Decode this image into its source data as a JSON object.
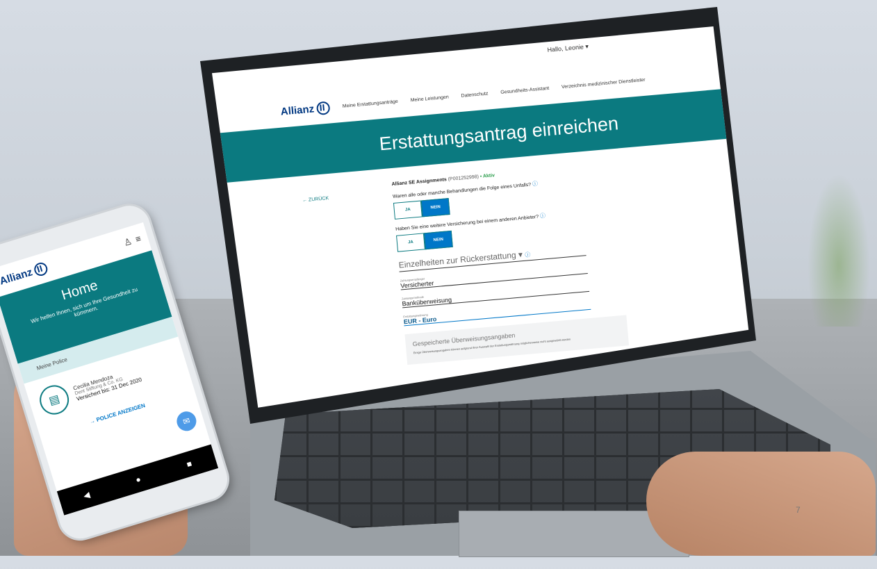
{
  "laptop": {
    "greeting": "Hallo, Leonie",
    "brand": "Allianz",
    "nav": [
      "Meine Erstattungsanträge",
      "Meine Leistungen",
      "Datenschutz",
      "Gesundheits-Assistant",
      "Verzeichnis medizinischer Dienstleister"
    ],
    "hero_title": "Erstattungsantrag einreichen",
    "back": "← ZURÜCK",
    "assignment_name": "Allianz SE Assignments",
    "policy_no": "(P001252998)",
    "status": "• Aktiv",
    "q1": "Waren alle oder manche Behandlungen die Folge eines Unfalls?",
    "q2": "Haben Sie eine weitere Versicherung bei einem anderen Anbieter?",
    "yes": "JA",
    "no": "NEIN",
    "details_title": "Einzelheiten zur Rückerstattung",
    "field1_label": "Zahlungsempfänger",
    "field1_value": "Versicherter",
    "field2_label": "Zahlungsmethode",
    "field2_value": "Banküberweisung",
    "field3_label": "Erstattungswährung",
    "field3_value": "EUR - Euro",
    "saved_title": "Gespeicherte Überweisungsangaben",
    "saved_desc": "Einige Überweisungsangaben können aufgrund Ihrer Auswahl der Erstattungswährung möglicherweise nicht ausgewählt werden"
  },
  "phone": {
    "brand": "Allianz",
    "hero_title": "Home",
    "hero_subtitle": "Wir helfen Ihnen, sich um Ihre Gesundheit zu kümmern.",
    "section": "Meine Police",
    "name": "Cecilia Mendoza",
    "company": "Dent Stiftung & Co. KG",
    "insured_until": "Versichert bis: 31 Dec 2020",
    "link": "→ POLICE ANZEIGEN"
  },
  "page_number": "7"
}
